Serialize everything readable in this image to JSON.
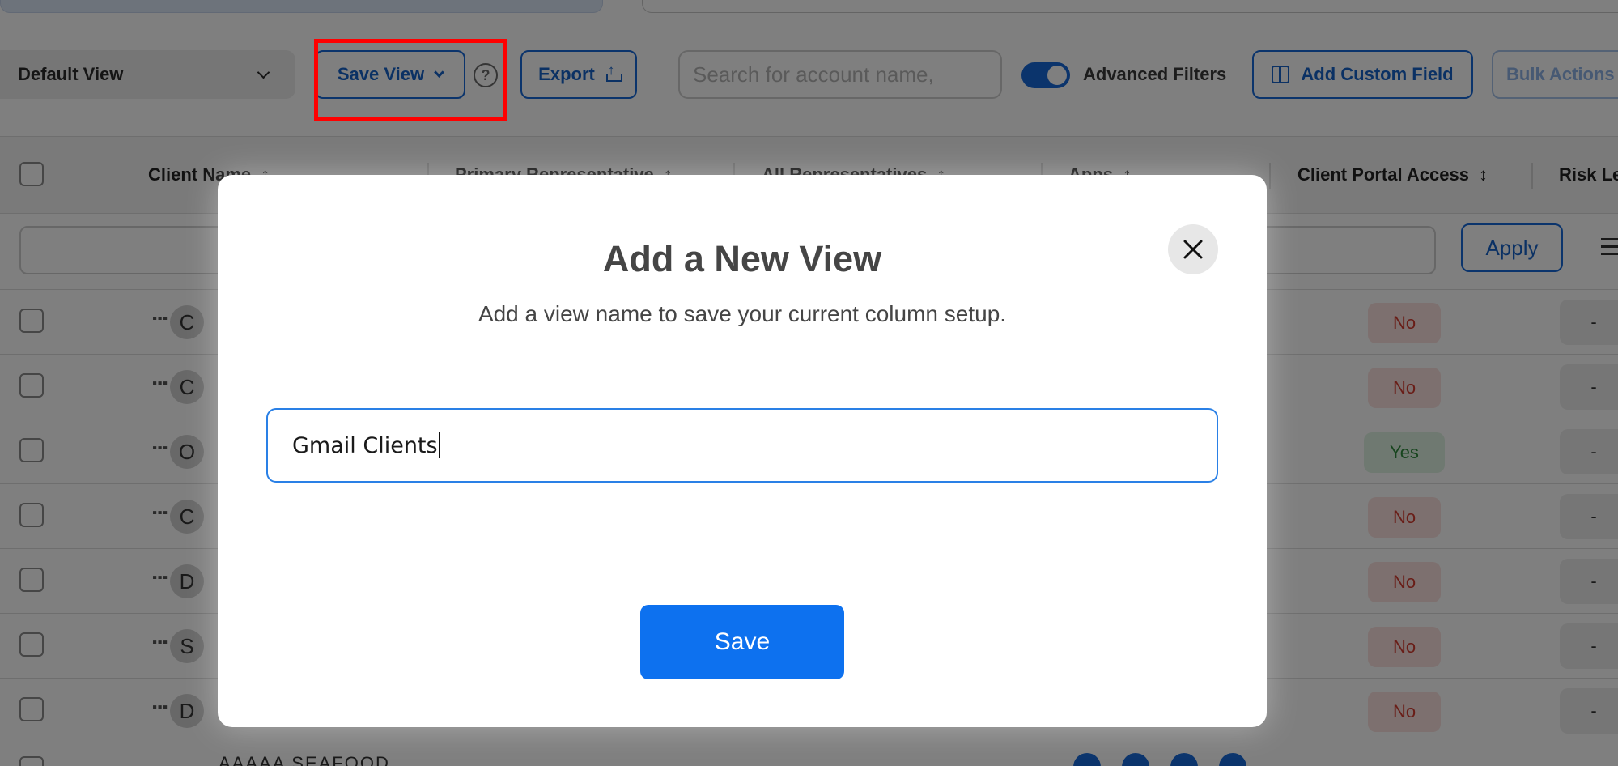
{
  "toolbar": {
    "view_select": "Default View",
    "save_view": "Save View",
    "help": "?",
    "export": "Export",
    "search_placeholder": "Search for account name,",
    "advanced_filters": "Advanced Filters",
    "advanced_filters_on": true,
    "add_custom_field": "Add Custom Field",
    "bulk_actions": "Bulk Actions"
  },
  "table": {
    "columns": [
      "Client Name",
      "Primary Representative",
      "All Representatives",
      "Apps",
      "Client Portal Access",
      "Risk Le"
    ],
    "sort_arrows": [
      "↑",
      "↑",
      "↑",
      "↑",
      "↕"
    ],
    "apply": "Apply",
    "rows": [
      {
        "initial": "C",
        "portal": "No",
        "risk": "-"
      },
      {
        "initial": "C",
        "portal": "No",
        "risk": "-"
      },
      {
        "initial": "O",
        "portal": "Yes",
        "risk": "-"
      },
      {
        "initial": "C",
        "portal": "No",
        "risk": "-"
      },
      {
        "initial": "D",
        "portal": "No",
        "risk": "-"
      },
      {
        "initial": "S",
        "portal": "No",
        "risk": "-"
      },
      {
        "initial": "D",
        "portal": "No",
        "risk": "-"
      }
    ],
    "partial_row_name": "AAAAA SEAFOOD"
  },
  "modal": {
    "title": "Add a New View",
    "subtitle": "Add a view name to save your current column setup.",
    "input_value": "Gmail Clients",
    "save": "Save"
  },
  "colors": {
    "primary": "#1769d8",
    "save_button": "#0d71ef",
    "highlight": "#ff0000",
    "no_text": "#d23a2e",
    "yes_text": "#2e8a3d"
  }
}
